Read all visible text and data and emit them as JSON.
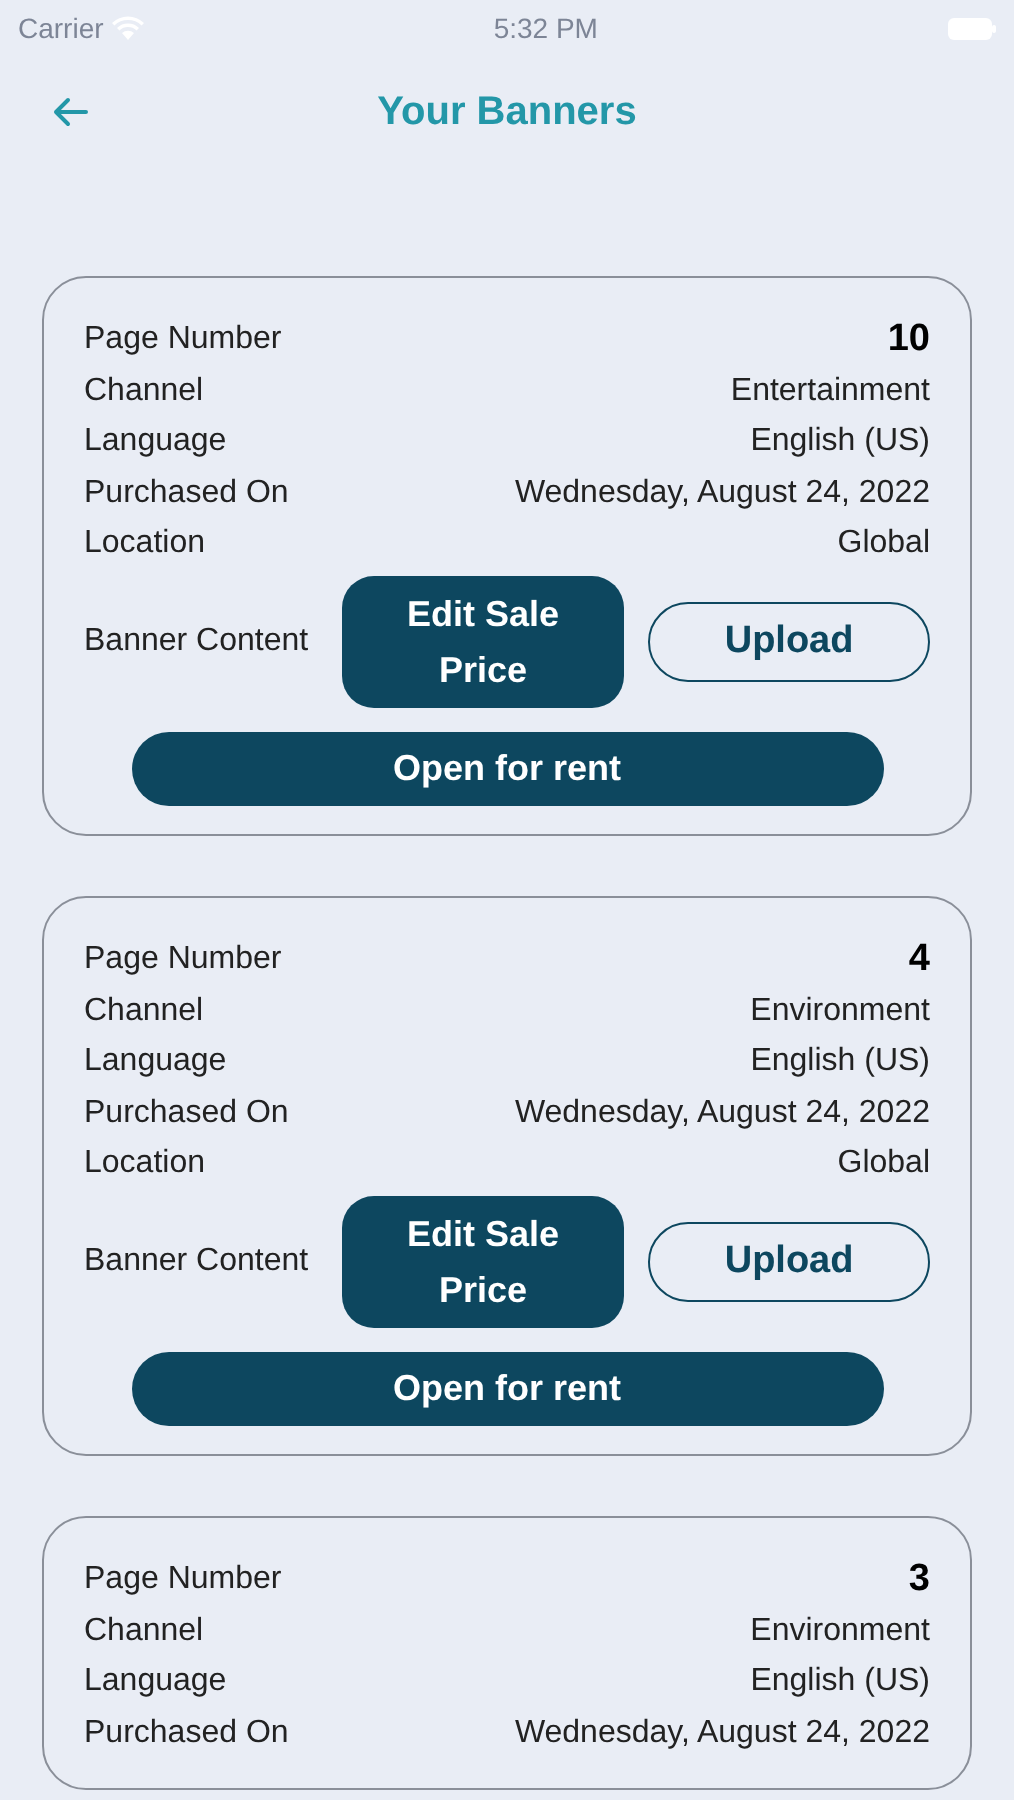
{
  "status_bar": {
    "carrier": "Carrier",
    "time": "5:32 PM"
  },
  "header": {
    "title": "Your Banners"
  },
  "cards": [
    {
      "page_label": "Page Number",
      "page_value": "10",
      "fields": [
        {
          "label": "Channel",
          "value": "Entertainment"
        },
        {
          "label": "Language",
          "value": "English (US)"
        },
        {
          "label": "Purchased On",
          "value": "Wednesday, August 24, 2022"
        },
        {
          "label": "Location",
          "value": "Global"
        }
      ],
      "content_label": "Banner Content",
      "edit_button": "Edit Sale Price",
      "upload_button": "Upload",
      "rent_button": "Open for rent"
    },
    {
      "page_label": "Page Number",
      "page_value": "4",
      "fields": [
        {
          "label": "Channel",
          "value": "Environment"
        },
        {
          "label": "Language",
          "value": "English (US)"
        },
        {
          "label": "Purchased On",
          "value": "Wednesday, August 24, 2022"
        },
        {
          "label": "Location",
          "value": "Global"
        }
      ],
      "content_label": "Banner Content",
      "edit_button": "Edit Sale Price",
      "upload_button": "Upload",
      "rent_button": "Open for rent"
    },
    {
      "page_label": "Page Number",
      "page_value": "3",
      "fields": [
        {
          "label": "Channel",
          "value": "Environment"
        },
        {
          "label": "Language",
          "value": "English (US)"
        },
        {
          "label": "Purchased On",
          "value": "Wednesday, August 24, 2022"
        }
      ]
    }
  ]
}
